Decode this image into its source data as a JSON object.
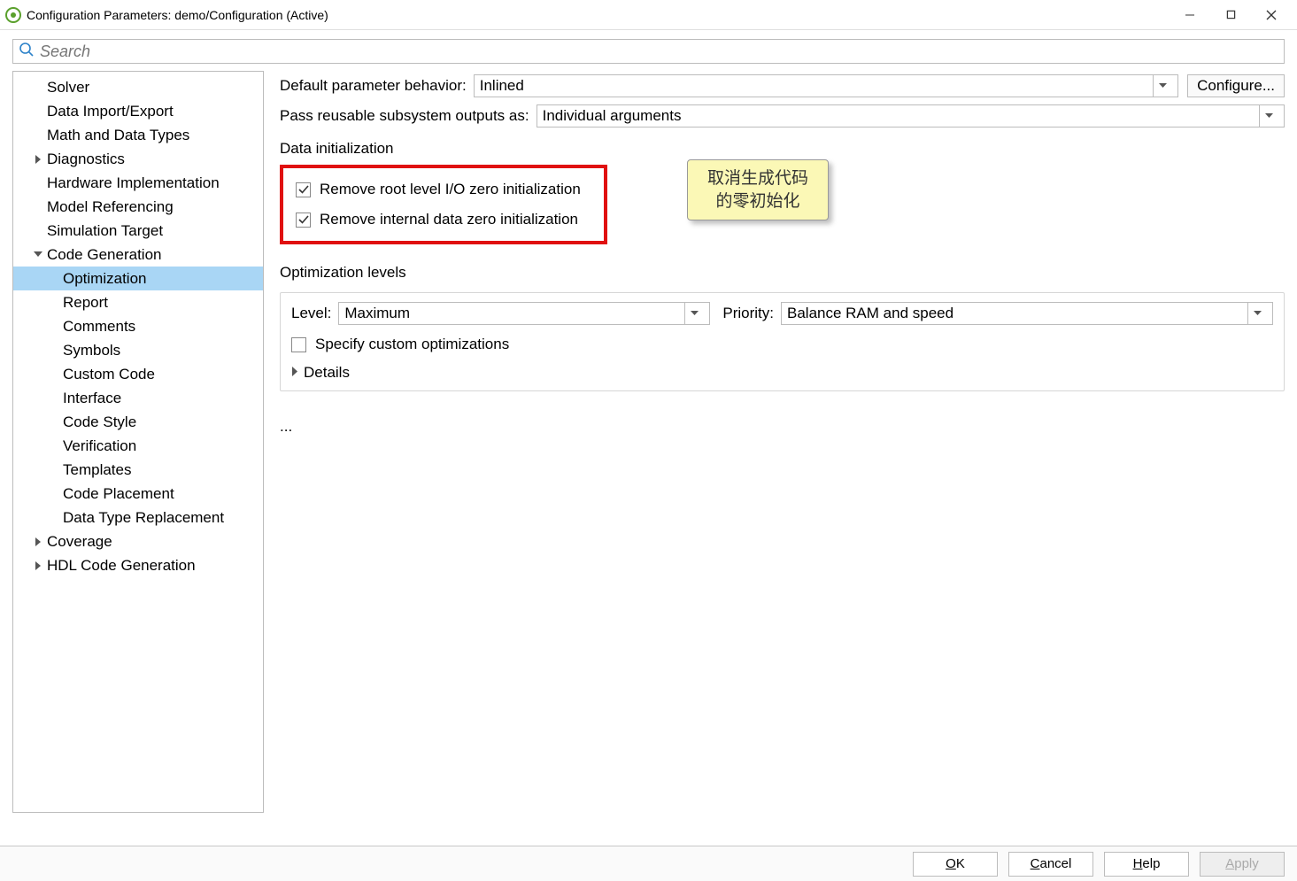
{
  "titlebar": {
    "title": "Configuration Parameters: demo/Configuration (Active)"
  },
  "search": {
    "placeholder": "Search"
  },
  "sidebar": {
    "items": [
      {
        "label": "Solver",
        "level": 0
      },
      {
        "label": "Data Import/Export",
        "level": 0
      },
      {
        "label": "Math and Data Types",
        "level": 0
      },
      {
        "label": "Diagnostics",
        "level": 0,
        "arrow": "right"
      },
      {
        "label": "Hardware Implementation",
        "level": 0
      },
      {
        "label": "Model Referencing",
        "level": 0
      },
      {
        "label": "Simulation Target",
        "level": 0
      },
      {
        "label": "Code Generation",
        "level": 0,
        "arrow": "down"
      },
      {
        "label": "Optimization",
        "level": 1,
        "selected": true
      },
      {
        "label": "Report",
        "level": 1
      },
      {
        "label": "Comments",
        "level": 1
      },
      {
        "label": "Symbols",
        "level": 1
      },
      {
        "label": "Custom Code",
        "level": 1
      },
      {
        "label": "Interface",
        "level": 1
      },
      {
        "label": "Code Style",
        "level": 1
      },
      {
        "label": "Verification",
        "level": 1
      },
      {
        "label": "Templates",
        "level": 1
      },
      {
        "label": "Code Placement",
        "level": 1
      },
      {
        "label": "Data Type Replacement",
        "level": 1
      },
      {
        "label": "Coverage",
        "level": 0,
        "arrow": "right"
      },
      {
        "label": "HDL Code Generation",
        "level": 0,
        "arrow": "right"
      }
    ]
  },
  "panel": {
    "defaultBehaviorLabel": "Default parameter behavior:",
    "defaultBehaviorValue": "Inlined",
    "configureBtn": "Configure...",
    "passReusableLabel": "Pass reusable subsystem outputs as:",
    "passReusableValue": "Individual arguments",
    "dataInitLabel": "Data initialization",
    "chkRootIO": "Remove root level I/O zero initialization",
    "chkInternal": "Remove internal data zero initialization",
    "calloutLine1": "取消生成代码",
    "calloutLine2": "的零初始化",
    "optLevelsLabel": "Optimization levels",
    "levelLabel": "Level:",
    "levelValue": "Maximum",
    "priorityLabel": "Priority:",
    "priorityValue": "Balance RAM and speed",
    "chkCustomOpt": "Specify custom optimizations",
    "detailsLabel": "Details",
    "ellipsis": "..."
  },
  "buttons": {
    "ok": "OK",
    "cancel": "Cancel",
    "help": "Help",
    "apply": "Apply"
  }
}
